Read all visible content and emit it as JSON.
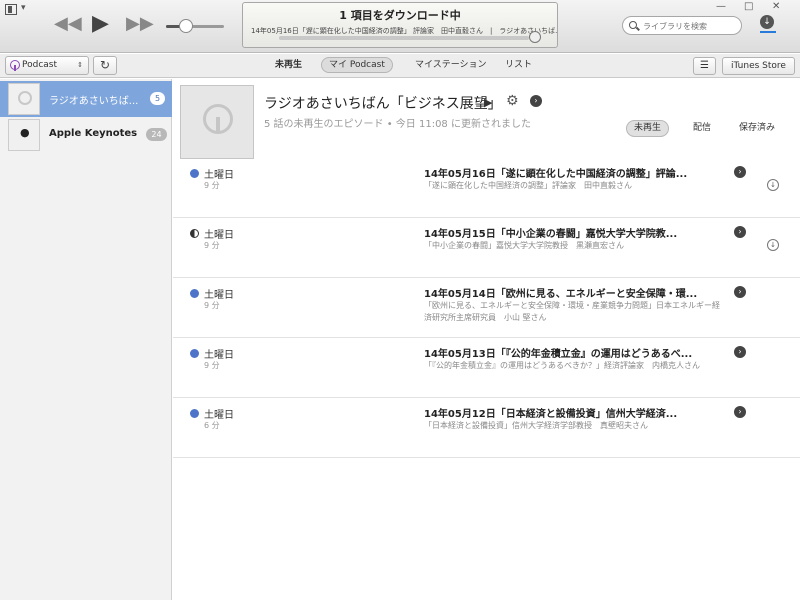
{
  "player": {
    "prev_icon": "◀◀",
    "play_icon": "▶",
    "next_icon": "▶▶",
    "volume_fraction": 0.35,
    "download_progress_fraction": 0.0
  },
  "lcd": {
    "title": "1 項目をダウンロード中",
    "subtitle": "14年05月16日「遅に顕在化した中国経済の調整」 評論家　田中直毅さん　|　ラジオあさいちば..."
  },
  "search": {
    "placeholder": "ライブラリを検索"
  },
  "toolbar": {
    "source_label": "Podcast",
    "source_arrows": "⇕",
    "refresh_icon": "↻",
    "tabs": [
      "未再生",
      "マイ Podcast",
      "マイステーション",
      "リスト"
    ],
    "list_icon": "☰",
    "store_label": "iTunes Store"
  },
  "sidebar": {
    "items": [
      {
        "label": "ラジオあさいちば...",
        "badge": "5"
      },
      {
        "label": "Apple Keynotes",
        "badge": "24"
      }
    ]
  },
  "podcast": {
    "title": "ラジオあさいちばん「ビジネス展望」",
    "play_icon": "▶",
    "gear_icon": "⚙",
    "more_icon": "›",
    "info": "5 話の未再生のエピソード • 今日 11:08 に更新されました",
    "filters": [
      "未再生",
      "配信",
      "保存済み"
    ]
  },
  "episodes": [
    {
      "day": "土曜日",
      "duration": "9 分",
      "title": "14年05月16日「遂に顕在化した中国経済の調整」評論...",
      "desc": "「遂に顕在化した中国経済の調整」評論家　田中直毅さん",
      "more": "›",
      "download": "↓"
    },
    {
      "day": "土曜日",
      "duration": "9 分",
      "title": "14年05月15日「中小企業の春闘」嘉悦大学大学院教...",
      "desc": "「中小企業の春闘」嘉悦大学大学院教授　黒瀬直宏さん",
      "more": "›",
      "download": "↓"
    },
    {
      "day": "土曜日",
      "duration": "9 分",
      "title": "14年05月14日「欧州に見る、エネルギーと安全保障・環...",
      "desc": "「欧州に見る、エネルギーと安全保障・環境・産業競争力問題」日本エネルギー経済研究所主席研究員　小山 堅さん",
      "more": "›"
    },
    {
      "day": "土曜日",
      "duration": "9 分",
      "title": "14年05月13日「『公的年金積立金』の運用はどうあるべ...",
      "desc": "「『公的年金積立金』の運用はどうあるべきか？」経済評論家　内橋克人さん",
      "more": "›"
    },
    {
      "day": "土曜日",
      "duration": "6 分",
      "title": "14年05月12日「日本経済と設備投資」信州大学経済...",
      "desc": "「日本経済と設備投資」信州大学経済学部教授　真壁昭夫さん",
      "more": "›"
    }
  ],
  "window": {
    "min_icon": "—",
    "max_icon": "□",
    "close_icon": "✕",
    "download_icon": "↓"
  }
}
